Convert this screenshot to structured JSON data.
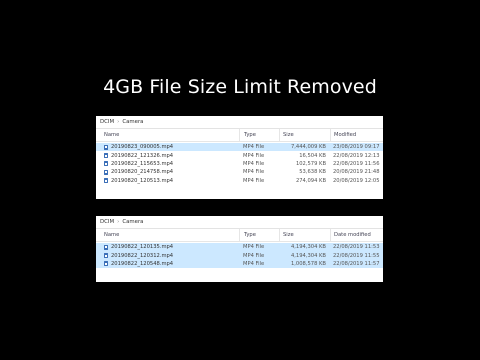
{
  "title": "4GB File Size Limit Removed",
  "panels": [
    {
      "breadcrumb": [
        "DCIM",
        "Camera"
      ],
      "columns": {
        "name": "Name",
        "type": "Type",
        "size": "Size",
        "modified": "Modified"
      },
      "rows": [
        {
          "name": "20190823_090005.mp4",
          "type": "MP4 File",
          "size": "7,444,009 KB",
          "modified": "23/08/2019 09:17",
          "selected": true
        },
        {
          "name": "20190822_121326.mp4",
          "type": "MP4 File",
          "size": "16,504 KB",
          "modified": "22/08/2019 12:13",
          "selected": false
        },
        {
          "name": "20190822_115653.mp4",
          "type": "MP4 File",
          "size": "102,579 KB",
          "modified": "22/08/2019 11:56",
          "selected": false
        },
        {
          "name": "20190820_214758.mp4",
          "type": "MP4 File",
          "size": "53,638 KB",
          "modified": "20/08/2019 21:48",
          "selected": false
        },
        {
          "name": "20190820_120513.mp4",
          "type": "MP4 File",
          "size": "274,094 KB",
          "modified": "20/08/2019 12:05",
          "selected": false
        }
      ]
    },
    {
      "breadcrumb": [
        "DCIM",
        "Camera"
      ],
      "columns": {
        "name": "Name",
        "type": "Type",
        "size": "Size",
        "modified": "Date modified"
      },
      "rows": [
        {
          "name": "20190822_120135.mp4",
          "type": "MP4 File",
          "size": "4,194,304 KB",
          "modified": "22/08/2019 11:53",
          "selected": true
        },
        {
          "name": "20190822_120312.mp4",
          "type": "MP4 File",
          "size": "4,194,304 KB",
          "modified": "22/08/2019 11:55",
          "selected": true
        },
        {
          "name": "20190822_120548.mp4",
          "type": "MP4 File",
          "size": "1,008,578 KB",
          "modified": "22/08/2019 11:57",
          "selected": true
        }
      ]
    }
  ]
}
